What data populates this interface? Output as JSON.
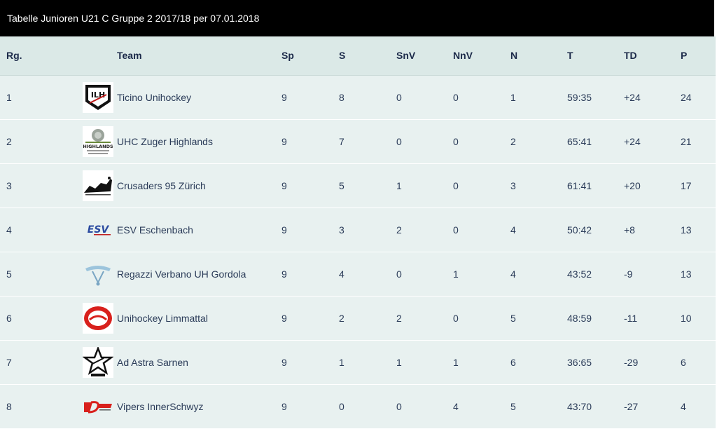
{
  "title": "Tabelle Junioren U21 C Gruppe 2 2017/18 per 07.01.2018",
  "columns": {
    "rank": "Rg.",
    "team": "Team",
    "sp": "Sp",
    "s": "S",
    "snv": "SnV",
    "nnv": "NnV",
    "n": "N",
    "t": "T",
    "td": "TD",
    "p": "P"
  },
  "rows": [
    {
      "rank": "1",
      "team": "Ticino Unihockey",
      "logo": "ticino-unihockey-logo-icon",
      "sp": "9",
      "s": "8",
      "snv": "0",
      "nnv": "0",
      "n": "1",
      "t": "59:35",
      "td": "+24",
      "p": "24"
    },
    {
      "rank": "2",
      "team": "UHC Zuger Highlands",
      "logo": "zuger-highlands-logo-icon",
      "logo_text": "HIGHLANDS",
      "sp": "9",
      "s": "7",
      "snv": "0",
      "nnv": "0",
      "n": "2",
      "t": "65:41",
      "td": "+24",
      "p": "21"
    },
    {
      "rank": "3",
      "team": "Crusaders 95 Zürich",
      "logo": "crusaders-logo-icon",
      "sp": "9",
      "s": "5",
      "snv": "1",
      "nnv": "0",
      "n": "3",
      "t": "61:41",
      "td": "+20",
      "p": "17"
    },
    {
      "rank": "4",
      "team": "ESV Eschenbach",
      "logo": "esv-eschenbach-logo-icon",
      "logo_text": "ESV",
      "sp": "9",
      "s": "3",
      "snv": "2",
      "nnv": "0",
      "n": "4",
      "t": "50:42",
      "td": "+8",
      "p": "13"
    },
    {
      "rank": "5",
      "team": "Regazzi Verbano UH Gordola",
      "logo": "regazzi-verbano-logo-icon",
      "sp": "9",
      "s": "4",
      "snv": "0",
      "nnv": "1",
      "n": "4",
      "t": "43:52",
      "td": "-9",
      "p": "13"
    },
    {
      "rank": "6",
      "team": "Unihockey Limmattal",
      "logo": "unihockey-limmattal-logo-icon",
      "sp": "9",
      "s": "2",
      "snv": "2",
      "nnv": "0",
      "n": "5",
      "t": "48:59",
      "td": "-11",
      "p": "10"
    },
    {
      "rank": "7",
      "team": "Ad Astra Sarnen",
      "logo": "ad-astra-sarnen-logo-icon",
      "sp": "9",
      "s": "1",
      "snv": "1",
      "nnv": "1",
      "n": "6",
      "t": "36:65",
      "td": "-29",
      "p": "6"
    },
    {
      "rank": "8",
      "team": "Vipers InnerSchwyz",
      "logo": "vipers-innerschwyz-logo-icon",
      "sp": "9",
      "s": "0",
      "snv": "0",
      "nnv": "4",
      "n": "5",
      "t": "43:70",
      "td": "-27",
      "p": "4"
    }
  ],
  "colors": {
    "titlebar_bg": "#000000",
    "header_bg": "#dbe9e7",
    "row_bg": "#e8f1f0",
    "text": "#2a3b58"
  }
}
